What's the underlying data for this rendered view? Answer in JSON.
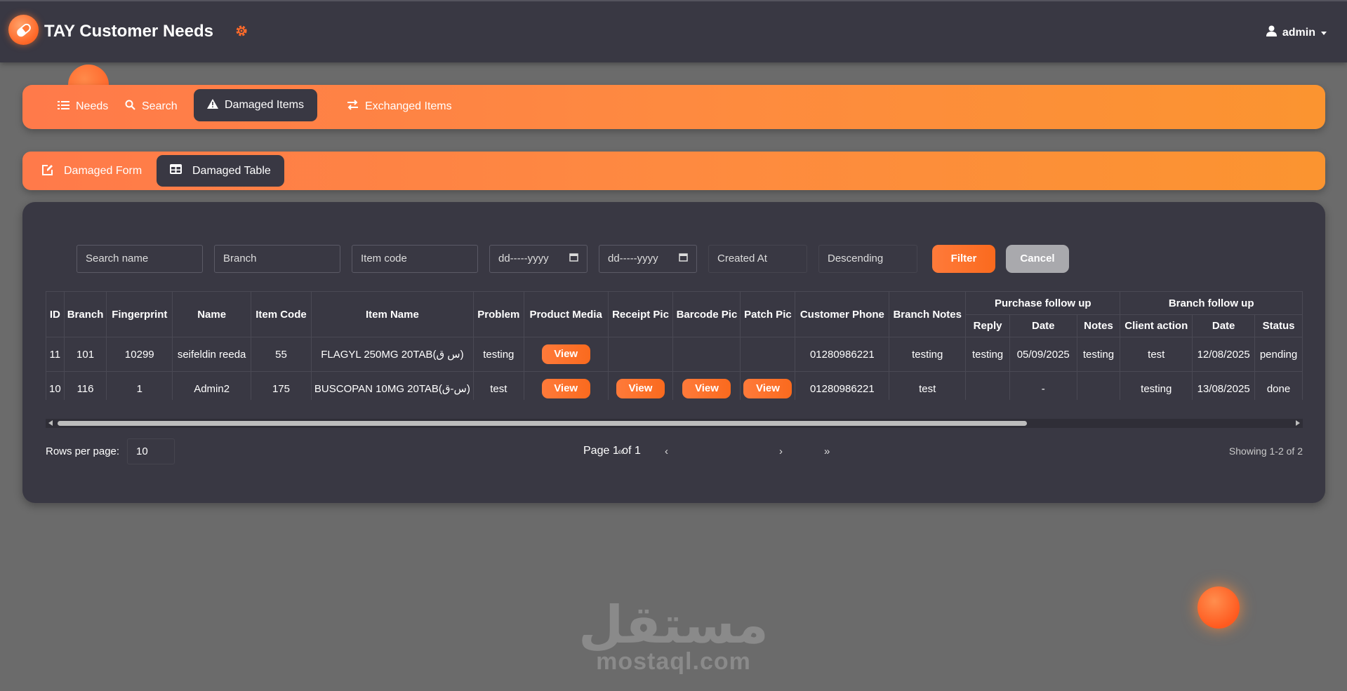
{
  "app": {
    "title": "TAY Customer Needs",
    "user": "admin"
  },
  "nav": {
    "items": [
      {
        "label": "Needs",
        "icon": "list-icon"
      },
      {
        "label": "Search",
        "icon": "search-icon"
      },
      {
        "label": "Damaged Items",
        "icon": "warning-icon",
        "active": true
      },
      {
        "label": "Exchanged Items",
        "icon": "exchange-icon"
      }
    ]
  },
  "subnav": {
    "items": [
      {
        "label": "Damaged Form",
        "icon": "edit-icon"
      },
      {
        "label": "Damaged Table",
        "icon": "table-icon",
        "active": true
      }
    ]
  },
  "filters": {
    "search_name": "Search name",
    "branch": "Branch",
    "item_code": "Item code",
    "date_from": "dd-----yyyy",
    "date_to": "dd-----yyyy",
    "sort_field": "Created At",
    "sort_order": "Descending",
    "filter_label": "Filter",
    "cancel_label": "Cancel"
  },
  "table": {
    "headers": {
      "id": "ID",
      "branch": "Branch",
      "fingerprint": "Fingerprint",
      "name": "Name",
      "item_code": "Item Code",
      "item_name": "Item Name",
      "problem": "Problem",
      "product_media": "Product Media",
      "receipt_pic": "Receipt Pic",
      "barcode_pic": "Barcode Pic",
      "patch_pic": "Patch Pic",
      "customer_phone": "Customer Phone",
      "branch_notes": "Branch Notes",
      "purchase_follow_up": "Purchase follow up",
      "reply": "Reply",
      "date": "Date",
      "notes": "Notes",
      "branch_follow_up": "Branch follow up",
      "client_action": "Client action",
      "date2": "Date",
      "status": "Status"
    },
    "view_label": "View",
    "rows": [
      {
        "id": "11",
        "branch": "101",
        "fingerprint": "10299",
        "name": "seifeldin reeda",
        "item_code": "55",
        "item_name": "FLAGYL 250MG 20TAB(س ق)",
        "problem": "testing",
        "product_media": true,
        "receipt_pic": false,
        "barcode_pic": false,
        "patch_pic": false,
        "customer_phone": "01280986221",
        "branch_notes": "testing",
        "reply": "testing",
        "date": "05/09/2025",
        "notes": "testing",
        "client_action": "test",
        "date2": "12/08/2025",
        "status": "pending"
      },
      {
        "id": "10",
        "branch": "116",
        "fingerprint": "1",
        "name": "Admin2",
        "item_code": "175",
        "item_name": "BUSCOPAN 10MG 20TAB(س-ق)",
        "problem": "test",
        "product_media": true,
        "receipt_pic": true,
        "barcode_pic": true,
        "patch_pic": true,
        "customer_phone": "01280986221",
        "branch_notes": "test",
        "reply": "",
        "date": "-",
        "notes": "",
        "client_action": "testing",
        "date2": "13/08/2025",
        "status": "done"
      }
    ]
  },
  "pagination": {
    "rows_label": "Rows per page:",
    "rows_value": "10",
    "first": "«",
    "prev": "‹",
    "page_info": "Page 1 of 1",
    "next": "›",
    "last": "»",
    "showing": "Showing 1-2 of 2"
  },
  "watermark": {
    "arabic": "مستقل",
    "latin": "mostaql.com"
  },
  "colors": {
    "accent": "#ff7a3a",
    "panel": "#393843",
    "background": "#6b6b6b"
  }
}
